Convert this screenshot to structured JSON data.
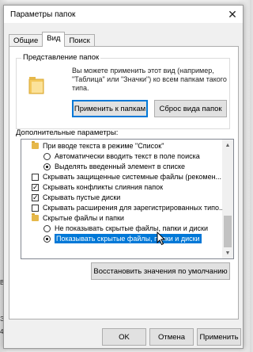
{
  "window": {
    "title": "Параметры папок",
    "close_glyph": "✕"
  },
  "tabs": [
    {
      "label": "Общие",
      "active": false
    },
    {
      "label": "Вид",
      "active": true
    },
    {
      "label": "Поиск",
      "active": false
    }
  ],
  "folder_view": {
    "group_label": "Представление папок",
    "description": "Вы можете применить этот вид (например, \"Таблица\" или \"Значки\") ко всем папкам такого типа.",
    "apply_button": "Применить к папкам",
    "reset_button": "Сброс вида папок"
  },
  "advanced": {
    "label": "Дополнительные параметры:",
    "items": [
      {
        "type": "folder",
        "label": "При вводе текста в режиме \"Список\""
      },
      {
        "type": "radio",
        "checked": false,
        "label": "Автоматически вводить текст в поле поиска"
      },
      {
        "type": "radio",
        "checked": true,
        "label": "Выделять введенный элемент в списке"
      },
      {
        "type": "checkbox",
        "checked": false,
        "label": "Скрывать защищенные системные файлы (рекомен..."
      },
      {
        "type": "checkbox",
        "checked": true,
        "label": "Скрывать конфликты слияния папок"
      },
      {
        "type": "checkbox",
        "checked": true,
        "label": "Скрывать пустые диски"
      },
      {
        "type": "checkbox",
        "checked": false,
        "label": "Скрывать расширения для зарегистрированных типо..."
      },
      {
        "type": "folder",
        "label": "Скрытые файлы и папки"
      },
      {
        "type": "radio",
        "checked": false,
        "label": "Не показывать скрытые файлы, папки и диски"
      },
      {
        "type": "radio",
        "checked": true,
        "label": "Показывать скрытые файлы, папки и диски",
        "selected": true
      }
    ],
    "restore_button": "Восстановить значения по умолчанию"
  },
  "footer": {
    "ok": "OK",
    "cancel": "Отмена",
    "apply": "Применить"
  },
  "background_text": [
    "В",
    "Э",
    "4"
  ],
  "colors": {
    "selection": "#0078d7",
    "focus_border": "#0078d7"
  },
  "icons": [
    "close-icon",
    "folder-icon",
    "cursor-icon",
    "scroll-up-icon",
    "scroll-down-icon"
  ]
}
